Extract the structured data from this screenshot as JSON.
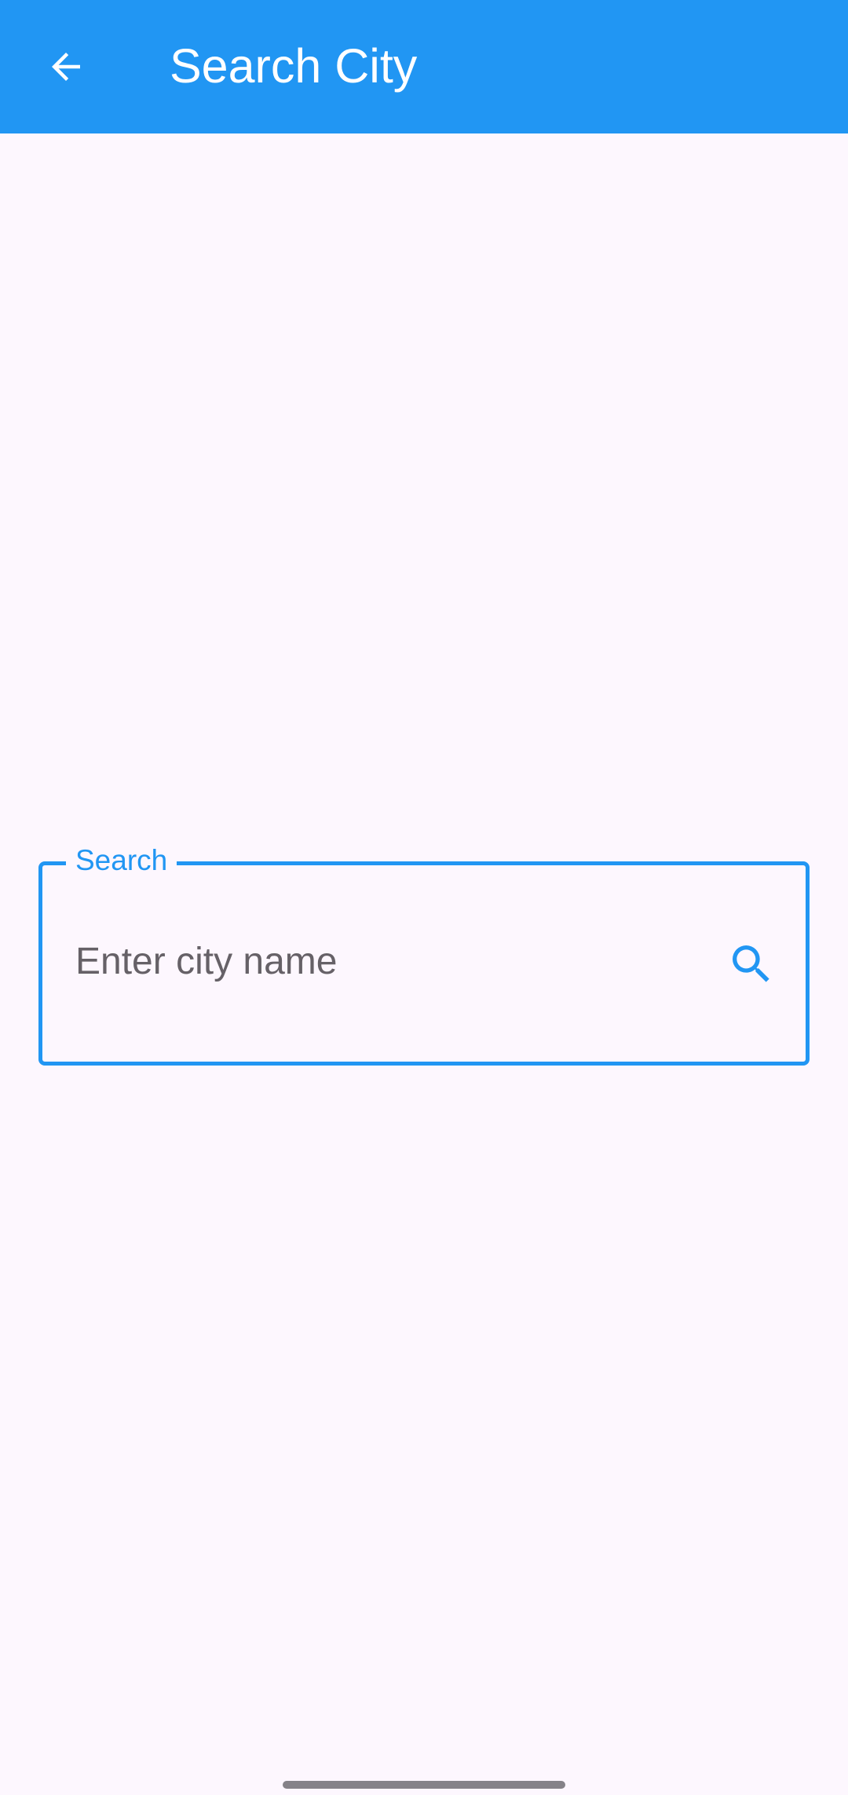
{
  "app_bar": {
    "title": "Search City",
    "back_icon": "arrow-back-icon",
    "background_color": "#2196F3"
  },
  "search": {
    "label": "Search",
    "placeholder": "Enter city name",
    "value": "",
    "icon": "search-icon",
    "accent_color": "#2196F3"
  },
  "system": {
    "home_indicator": "gesture-bar"
  }
}
